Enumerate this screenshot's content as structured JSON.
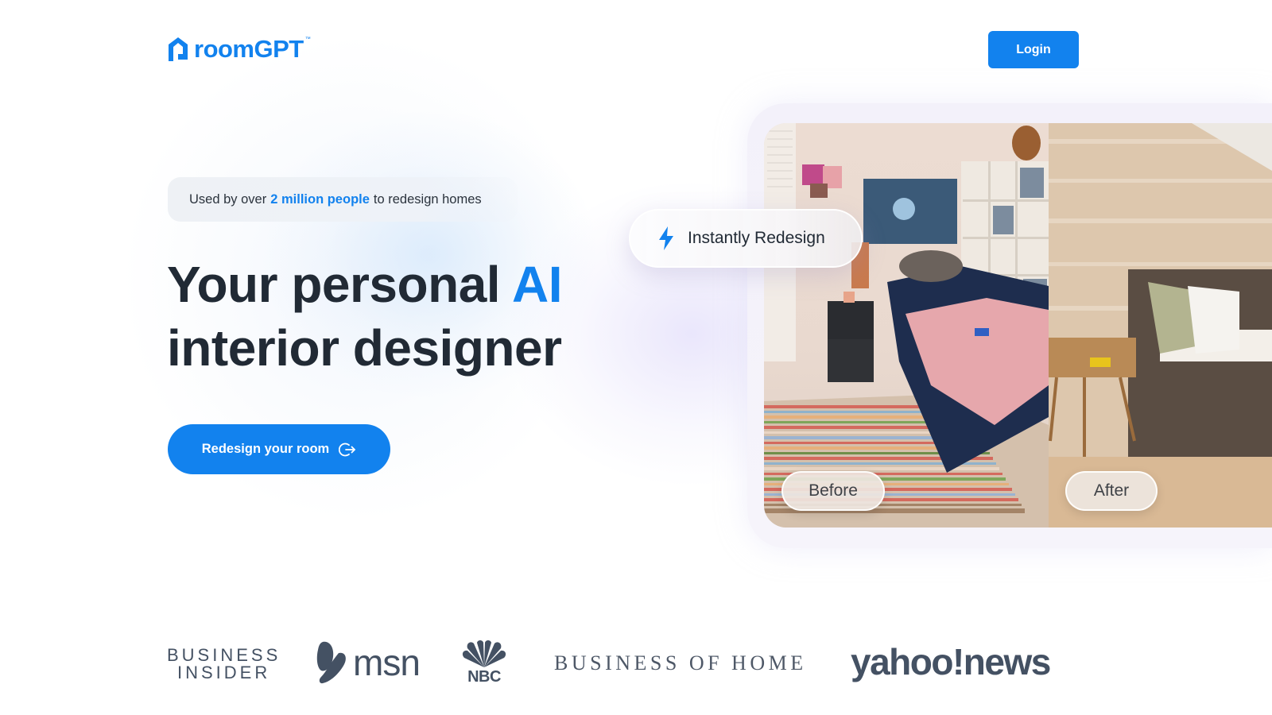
{
  "header": {
    "brand": "roomGPT",
    "brand_tm": "™",
    "login_label": "Login"
  },
  "hero": {
    "badge": {
      "prefix": "Used by over",
      "highlight": "2 million people",
      "suffix": "to redesign homes"
    },
    "headline": {
      "line1_prefix": "Your personal",
      "line1_accent": "AI",
      "line2": "interior designer"
    },
    "cta_label": "Redesign your room",
    "cta_icon": "arrow-exit-icon"
  },
  "showcase": {
    "instant_label": "Instantly Redesign",
    "instant_icon": "lightning-bolt-icon",
    "before_label": "Before",
    "after_label": "After"
  },
  "press": {
    "business_insider": [
      "BUSINESS",
      "INSIDER"
    ],
    "msn": "msn",
    "nbc": "NBC",
    "business_of_home": "BUSINESS OF HOME",
    "yahoo_news": "yahoo!news"
  },
  "colors": {
    "accent": "#1282ee",
    "text": "#212a35",
    "press_logo": "#445163"
  }
}
